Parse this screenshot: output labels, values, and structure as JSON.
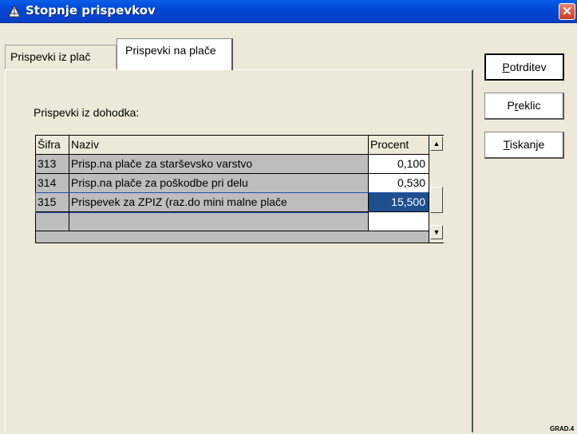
{
  "window": {
    "title": "Stopnje prispevkov"
  },
  "tabs": [
    {
      "label": "Prispevki iz plač",
      "active": false
    },
    {
      "label": "Prispevki na plače",
      "active": true
    }
  ],
  "panel": {
    "section_label": "Prispevki iz dohodka:"
  },
  "grid": {
    "columns": [
      "Šifra",
      "Naziv",
      "Procent"
    ],
    "rows": [
      {
        "sifra": "313",
        "naziv": "Prisp.na plače za starševsko varstvo",
        "procent": "0,100"
      },
      {
        "sifra": "314",
        "naziv": "Prisp.na plače za poškodbe pri delu",
        "procent": "0,530"
      },
      {
        "sifra": "315",
        "naziv": "Prispevek za ZPIZ (raz.do mini malne plače",
        "procent": "15,500",
        "selected": true
      },
      {
        "sifra": "",
        "naziv": "",
        "procent": ""
      }
    ]
  },
  "buttons": {
    "ok": {
      "mnemonic": "P",
      "rest": "otrditev"
    },
    "cancel": {
      "pre": "P",
      "mnemonic": "r",
      "rest": "eklic"
    },
    "print": {
      "mnemonic": "T",
      "rest": "iskanje"
    }
  },
  "corner_label": "GRAD.4",
  "colors": {
    "title_bar": "#0a5fe8",
    "selection": "#1f4f8f",
    "close_button": "#c93c20"
  }
}
